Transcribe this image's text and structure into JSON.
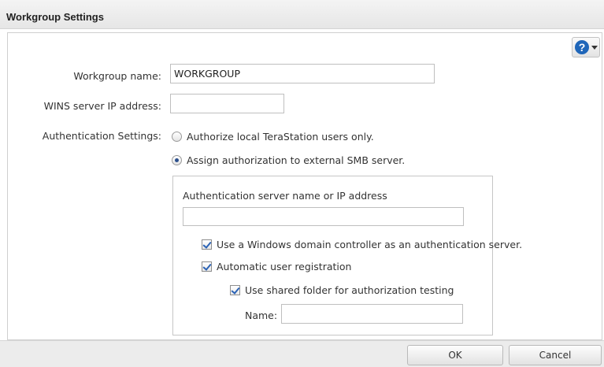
{
  "dialog": {
    "title": "Workgroup Settings",
    "help_icon": "help-question-icon"
  },
  "form": {
    "workgroup": {
      "label": "Workgroup name:",
      "value": "WORKGROUP"
    },
    "wins": {
      "label": "WINS server IP address:",
      "value": ""
    },
    "auth": {
      "label": "Authentication Settings:",
      "options": [
        {
          "label": "Authorize local TeraStation users only.",
          "selected": false
        },
        {
          "label": "Assign authorization to external SMB server.",
          "selected": true
        }
      ]
    },
    "external": {
      "server_label": "Authentication server name or IP address",
      "server_value": "",
      "use_windows_dc": {
        "label": "Use a Windows domain controller as an authentication server.",
        "checked": true
      },
      "auto_registration": {
        "label": "Automatic user registration",
        "checked": true
      },
      "shared_folder": {
        "label": "Use shared folder for authorization testing",
        "checked": true
      },
      "name": {
        "label": "Name:",
        "value": ""
      }
    }
  },
  "buttons": {
    "ok": "OK",
    "cancel": "Cancel"
  },
  "colors": {
    "help_icon": "#1f66b9",
    "check_mark": "#2a62b5",
    "radio_dot": "#2b4f8c"
  }
}
